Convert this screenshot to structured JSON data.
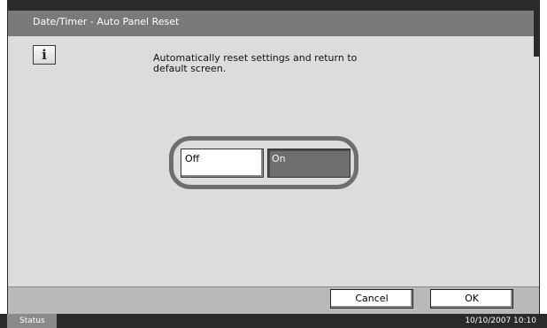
{
  "window": {
    "title": "Date/Timer - Auto Panel Reset"
  },
  "info": {
    "icon": "info-icon",
    "icon_glyph": "i",
    "message_line1": "Automatically reset settings and return to",
    "message_line2": "default screen."
  },
  "toggle": {
    "off_label": "Off",
    "on_label": "On",
    "selected": "On"
  },
  "footer": {
    "cancel_label": "Cancel",
    "ok_label": "OK"
  },
  "status_bar": {
    "status_label": "Status",
    "datetime": "10/10/2007   10:10"
  }
}
